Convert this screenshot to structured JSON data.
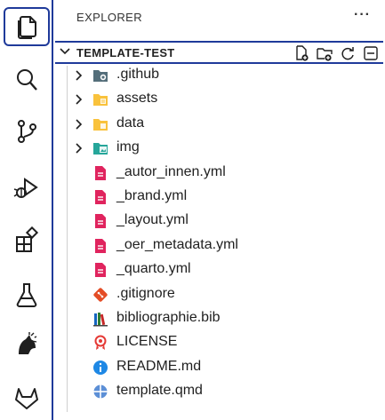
{
  "explorer": {
    "title": "EXPLORER",
    "more": "···",
    "section_title": "TEMPLATE-TEST"
  },
  "activity_bar": [
    {
      "name": "explorer-icon",
      "active": true
    },
    {
      "name": "search-icon"
    },
    {
      "name": "source-control-icon"
    },
    {
      "name": "run-debug-icon"
    },
    {
      "name": "extensions-icon"
    },
    {
      "name": "testing-icon"
    },
    {
      "name": "extension-custom-icon"
    },
    {
      "name": "gitlab-icon"
    }
  ],
  "tree": [
    {
      "label": ".github",
      "type": "folder",
      "icon": "folder-github-icon",
      "color": "#546e7a"
    },
    {
      "label": "assets",
      "type": "folder",
      "icon": "folder-assets-icon",
      "color": "#f9c23c"
    },
    {
      "label": "data",
      "type": "folder",
      "icon": "folder-data-icon",
      "color": "#f9c23c"
    },
    {
      "label": "img",
      "type": "folder",
      "icon": "folder-images-icon",
      "color": "#26a69a"
    },
    {
      "label": "_autor_innen.yml",
      "type": "file",
      "icon": "yaml-file-icon",
      "color": "#e0245e"
    },
    {
      "label": "_brand.yml",
      "type": "file",
      "icon": "yaml-file-icon",
      "color": "#e0245e"
    },
    {
      "label": "_layout.yml",
      "type": "file",
      "icon": "yaml-file-icon",
      "color": "#e0245e"
    },
    {
      "label": "_oer_metadata.yml",
      "type": "file",
      "icon": "yaml-file-icon",
      "color": "#e0245e"
    },
    {
      "label": "_quarto.yml",
      "type": "file",
      "icon": "yaml-file-icon",
      "color": "#e0245e"
    },
    {
      "label": ".gitignore",
      "type": "file",
      "icon": "git-file-icon",
      "color": "#e44d26"
    },
    {
      "label": "bibliographie.bib",
      "type": "file",
      "icon": "bibtex-file-icon",
      "color": "#c62828"
    },
    {
      "label": "LICENSE",
      "type": "file",
      "icon": "license-file-icon",
      "color": "#e53935"
    },
    {
      "label": "README.md",
      "type": "file",
      "icon": "info-file-icon",
      "color": "#1e88e5"
    },
    {
      "label": "template.qmd",
      "type": "file",
      "icon": "quarto-file-icon",
      "color": "#5c8fd6"
    }
  ]
}
